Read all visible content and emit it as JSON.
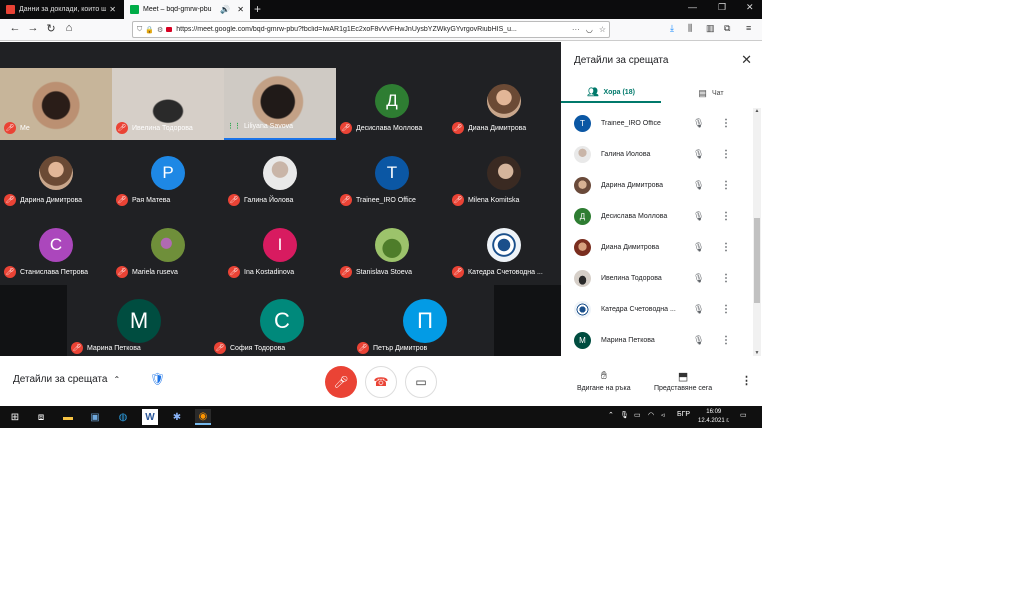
{
  "browser": {
    "tabs": [
      {
        "title": "Данни за доклади, които ще ...",
        "favicon_color": "#ea4335"
      },
      {
        "title": "Meet – bqd-gmrw-pbu",
        "favicon_color": "#00ac47"
      }
    ],
    "url": "https://meet.google.com/bqd-gmrw-pbu?fbclid=IwAR1g1Ec2xoF8vVvFHwJnUysbYZWkyGYvrgovRiubHIS_u..."
  },
  "grid": {
    "tiles": [
      {
        "name": "Me",
        "initial": "",
        "color": "",
        "muted": true
      },
      {
        "name": "Ивелина Тодорова",
        "initial": "",
        "color": "",
        "muted": true
      },
      {
        "name": "Liliyana Savova",
        "initial": "",
        "color": "",
        "muted": false
      },
      {
        "name": "Десислава Моллова",
        "initial": "Д",
        "color": "#2e7d32",
        "muted": true
      },
      {
        "name": "Диана Димитрова",
        "initial": "",
        "color": "",
        "muted": true
      },
      {
        "name": "Дарина Димитрова",
        "initial": "",
        "color": "",
        "muted": true
      },
      {
        "name": "Рая Матева",
        "initial": "Р",
        "color": "#1e88e5",
        "muted": true
      },
      {
        "name": "Галина Йолова",
        "initial": "",
        "color": "",
        "muted": true
      },
      {
        "name": "Trainee_IRO Office",
        "initial": "Т",
        "color": "#0b57a4",
        "muted": true
      },
      {
        "name": "Milena Komitska",
        "initial": "",
        "color": "",
        "muted": true
      },
      {
        "name": "Станислава Петрова",
        "initial": "С",
        "color": "#ab47bc",
        "muted": true
      },
      {
        "name": "Mariela ruseva",
        "initial": "",
        "color": "",
        "muted": true
      },
      {
        "name": "Ina Kostadinova",
        "initial": "I",
        "color": "#d81b60",
        "muted": true
      },
      {
        "name": "Stanislava Stoeva",
        "initial": "",
        "color": "",
        "muted": true
      },
      {
        "name": "Катедра Счетоводна ...",
        "initial": "",
        "color": "",
        "muted": true
      }
    ],
    "big_tiles": [
      {
        "name": "Марина Петкова",
        "initial": "М",
        "color": "#004d40",
        "muted": true
      },
      {
        "name": "София Тодорова",
        "initial": "С",
        "color": "#00897b",
        "muted": true
      },
      {
        "name": "Петър Димитров",
        "initial": "П",
        "color": "#039be5",
        "muted": true
      }
    ]
  },
  "controls": {
    "details_label": "Детайли за срещата"
  },
  "panel": {
    "title": "Детайли за срещата",
    "tab_people": "Хора (18)",
    "tab_chat": "Чат",
    "people": [
      {
        "name": "Trainee_IRO Office",
        "initial": "T",
        "color": "#0b57a4"
      },
      {
        "name": "Галина Йолова",
        "initial": "",
        "color": ""
      },
      {
        "name": "Дарина Димитрова",
        "initial": "",
        "color": ""
      },
      {
        "name": "Десислава Моллова",
        "initial": "Д",
        "color": "#2e7d32"
      },
      {
        "name": "Диана Димитрова",
        "initial": "",
        "color": ""
      },
      {
        "name": "Ивелина Тодорова",
        "initial": "",
        "color": ""
      },
      {
        "name": "Катедра Счетоводна ...",
        "initial": "",
        "color": ""
      },
      {
        "name": "Марина Петкова",
        "initial": "М",
        "color": "#004d40"
      }
    ],
    "raise_hand": "Вдигане на ръка",
    "present_now": "Представяне сега"
  },
  "taskbar": {
    "language": "БГР",
    "time": "16:09",
    "date": "12.4.2021 г."
  }
}
